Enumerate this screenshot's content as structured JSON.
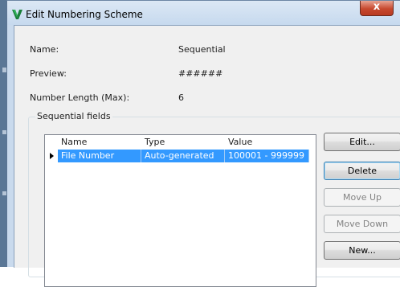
{
  "dialog": {
    "title": "Edit Numbering Scheme",
    "close_glyph": "x",
    "icon": "app-icon",
    "close_color": "#c7492f"
  },
  "fields": {
    "name_label": "Name:",
    "name_value": "Sequential",
    "preview_label": "Preview:",
    "preview_value": "######",
    "length_label": "Number Length (Max):",
    "length_value": "6"
  },
  "sequential": {
    "group_title": "Sequential fields",
    "columns": [
      "Name",
      "Type",
      "Value"
    ],
    "rows": [
      {
        "name": "File Number",
        "type": "Auto-generated",
        "value": "100001 - 999999",
        "selected": true
      }
    ],
    "selection_color": "#3399ff"
  },
  "buttons": {
    "edit": "Edit...",
    "delete": "Delete",
    "move_up": "Move Up",
    "move_down": "Move Down",
    "new": "New..."
  }
}
